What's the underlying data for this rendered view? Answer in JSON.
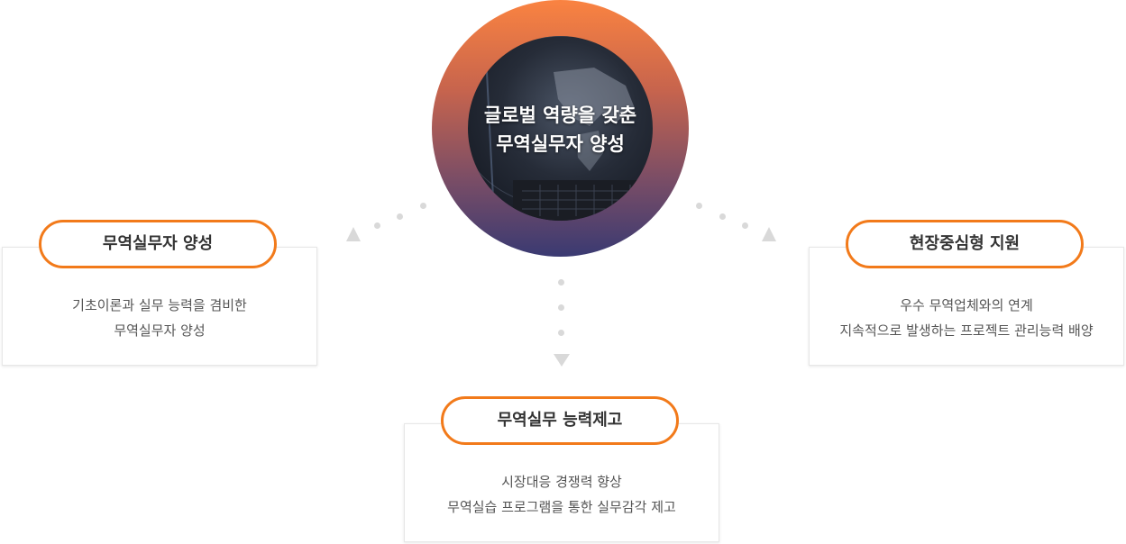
{
  "center": {
    "title_line1": "글로벌 역량을 갖춘",
    "title_line2": "무역실무자 양성"
  },
  "cards": [
    {
      "title": "무역실무자 양성",
      "lines": [
        "기초이론과 실무 능력을 겸비한",
        "무역실무자 양성"
      ]
    },
    {
      "title": "현장중심형 지원",
      "lines": [
        "우수 무역업체와의 연계",
        "지속적으로 발생하는 프로젝트 관리능력 배양"
      ]
    },
    {
      "title": "무역실무 능력제고",
      "lines": [
        "시장대응 경쟁력 향상",
        "무역실습 프로그램을 통한 실무감각 제고"
      ]
    }
  ],
  "colors": {
    "accent": "#f27a1a",
    "connector": "#d9d9d9"
  }
}
